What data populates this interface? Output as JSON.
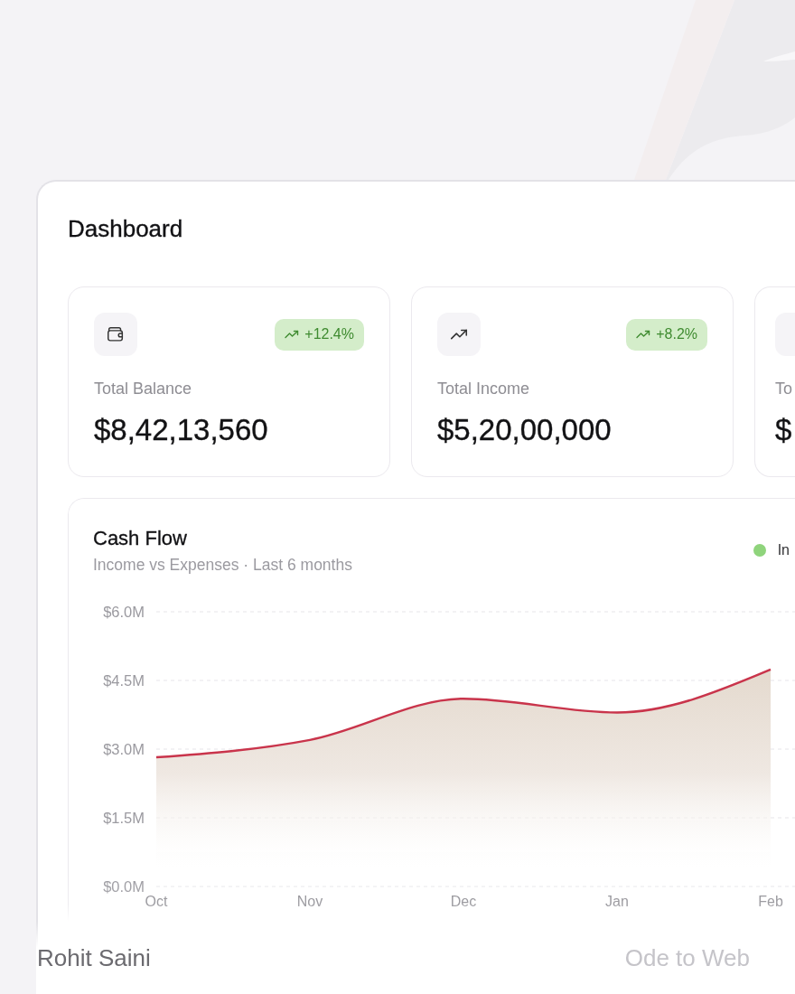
{
  "page": {
    "title": "Dashboard"
  },
  "stat_cards": [
    {
      "label": "Total Balance",
      "value": "$8,42,13,560",
      "badge": "+12.4%"
    },
    {
      "label": "Total Income",
      "value": "$5,20,00,000",
      "badge": "+8.2%"
    },
    {
      "label": "To",
      "value": "$"
    }
  ],
  "cash_flow": {
    "title": "Cash Flow",
    "subtitle": "Income vs Expenses · Last 6 months",
    "legend": [
      {
        "label": "In",
        "color": "#8fd47c"
      }
    ],
    "chart_data": {
      "type": "area",
      "grid": true,
      "categories": [
        "Oct",
        "Nov",
        "Dec",
        "Jan",
        "Feb"
      ],
      "values": [
        2.82,
        3.2,
        4.1,
        3.8,
        4.74
      ],
      "ylim": [
        0,
        6
      ],
      "yticks": [
        {
          "value": 0,
          "label": "$0.0M"
        },
        {
          "value": 1.5,
          "label": "$1.5M"
        },
        {
          "value": 3,
          "label": "$3.0M"
        },
        {
          "value": 4.5,
          "label": "$4.5M"
        },
        {
          "value": 6,
          "label": "$6.0M"
        }
      ]
    }
  },
  "footer": {
    "author": "Rohit Saini",
    "brand": "Ode to Web"
  }
}
